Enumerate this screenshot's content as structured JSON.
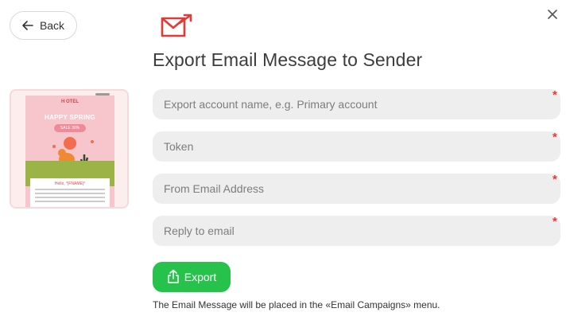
{
  "header": {
    "back_label": "Back",
    "title": "Export Email Message to Sender"
  },
  "preview": {
    "logo": "H OTEL",
    "headline": "HAPPY SPRING",
    "sale": "SALE 30%",
    "greeting": "Hello, *|FNAME|*"
  },
  "form": {
    "fields": [
      {
        "placeholder": "Export account name, e.g. Primary account",
        "required": "*"
      },
      {
        "placeholder": "Token",
        "required": "*"
      },
      {
        "placeholder": "From Email Address",
        "required": "*"
      },
      {
        "placeholder": "Reply to email",
        "required": "*"
      }
    ],
    "export_label": "Export",
    "note": "The Email Message will be placed in the «Email Campaigns» menu."
  },
  "colors": {
    "accent": "#27c24c",
    "required": "#e53935",
    "brand_icon": "#e53935"
  },
  "icons": [
    "arrow-left-icon",
    "close-icon",
    "email-send-icon",
    "upload-icon"
  ]
}
